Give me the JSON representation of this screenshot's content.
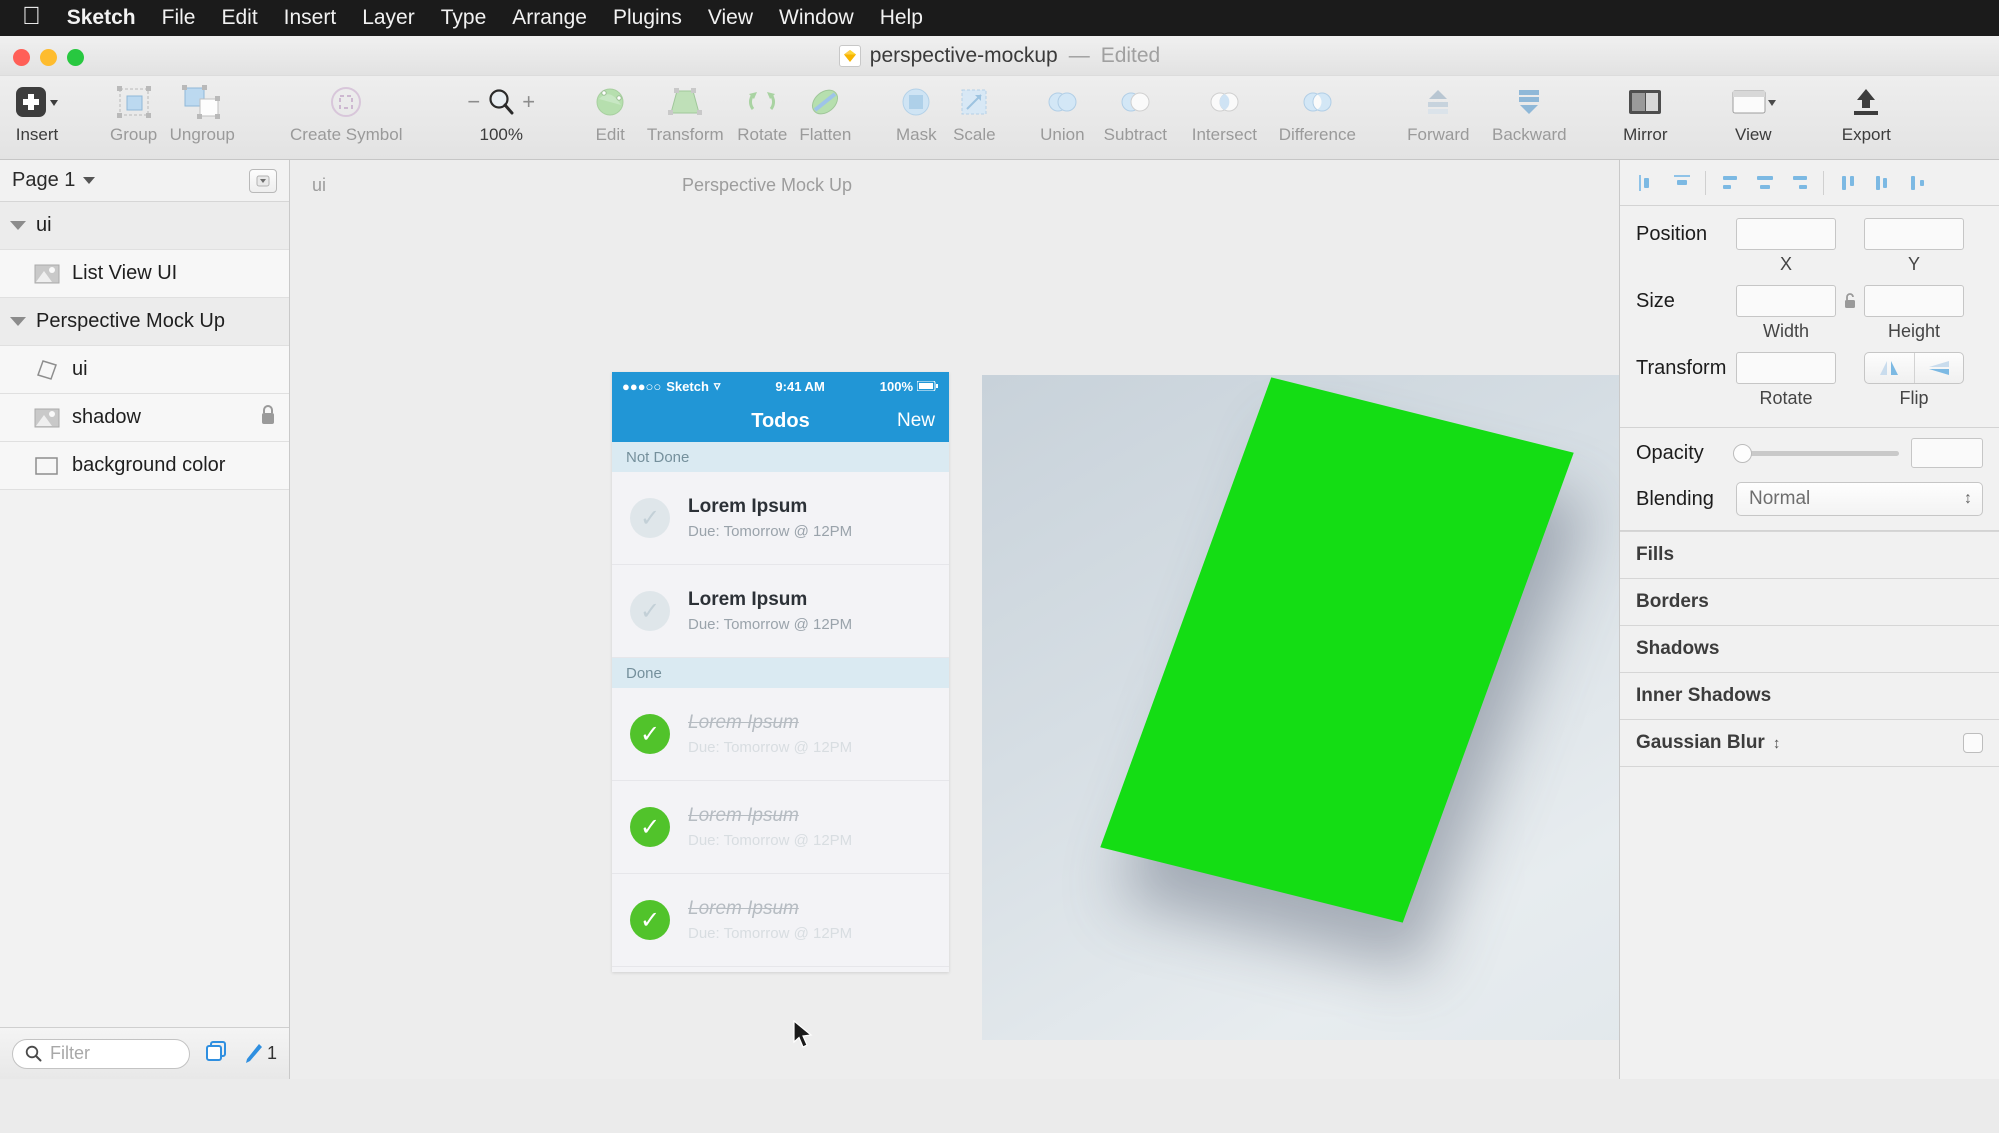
{
  "menubar": {
    "apple": "apple-logo",
    "items": [
      {
        "label": "Sketch",
        "bold": true
      },
      {
        "label": "File",
        "bold": false
      },
      {
        "label": "Edit",
        "bold": false
      },
      {
        "label": "Insert",
        "bold": false
      },
      {
        "label": "Layer",
        "bold": false
      },
      {
        "label": "Type",
        "bold": false
      },
      {
        "label": "Arrange",
        "bold": false
      },
      {
        "label": "Plugins",
        "bold": false
      },
      {
        "label": "View",
        "bold": false
      },
      {
        "label": "Window",
        "bold": false
      },
      {
        "label": "Help",
        "bold": false
      }
    ]
  },
  "titlebar": {
    "document_name": "perspective-mockup",
    "separator": "—",
    "edit_state": "Edited"
  },
  "toolbar": {
    "insert": "Insert",
    "group": "Group",
    "ungroup": "Ungroup",
    "create_symbol": "Create Symbol",
    "zoom_out": "−",
    "zoom_in": "+",
    "zoom_level": "100%",
    "edit": "Edit",
    "transform": "Transform",
    "rotate": "Rotate",
    "flatten": "Flatten",
    "mask": "Mask",
    "scale": "Scale",
    "union": "Union",
    "subtract": "Subtract",
    "intersect": "Intersect",
    "difference": "Difference",
    "forward": "Forward",
    "backward": "Backward",
    "mirror": "Mirror",
    "view": "View",
    "export": "Export"
  },
  "layers": {
    "page_name": "Page 1",
    "items": [
      {
        "name": "ui",
        "type": "group",
        "depth": 0,
        "expanded": true,
        "icon": "disclosure-triangle",
        "locked": false
      },
      {
        "name": "List View UI",
        "type": "bitmap",
        "depth": 1,
        "expanded": false,
        "icon": "image-icon",
        "locked": false
      },
      {
        "name": "Perspective Mock Up",
        "type": "group",
        "depth": 0,
        "expanded": true,
        "icon": "disclosure-triangle",
        "locked": false
      },
      {
        "name": "ui",
        "type": "shape",
        "depth": 1,
        "expanded": false,
        "icon": "parallelogram-icon",
        "locked": false
      },
      {
        "name": "shadow",
        "type": "bitmap",
        "depth": 1,
        "expanded": false,
        "icon": "image-icon",
        "locked": true
      },
      {
        "name": "background color",
        "type": "rectangle",
        "depth": 1,
        "expanded": false,
        "icon": "rectangle-icon",
        "locked": false
      }
    ],
    "filter_placeholder": "Filter",
    "pen_count": "1"
  },
  "canvas": {
    "artboard_ui_label": "ui",
    "artboard_perspective_label": "Perspective Mock Up",
    "mockup": {
      "carrier_dots": "●●●○○",
      "carrier": "Sketch",
      "wifi": "wifi-icon",
      "time": "9:41 AM",
      "battery": "100%",
      "nav_title": "Todos",
      "nav_action": "New",
      "sections": [
        {
          "header": "Not Done",
          "rows": [
            {
              "title": "Lorem Ipsum",
              "due": "Due: Tomorrow @ 12PM",
              "done": false
            },
            {
              "title": "Lorem Ipsum",
              "due": "Due: Tomorrow @ 12PM",
              "done": false
            }
          ]
        },
        {
          "header": "Done",
          "rows": [
            {
              "title": "Lorem Ipsum",
              "due": "Due: Tomorrow @ 12PM",
              "done": true
            },
            {
              "title": "Lorem Ipsum",
              "due": "Due: Tomorrow @ 12PM",
              "done": true
            },
            {
              "title": "Lorem Ipsum",
              "due": "Due: Tomorrow @ 12PM",
              "done": true
            }
          ]
        }
      ]
    },
    "card_color": "#14DD14"
  },
  "inspector": {
    "position_label": "Position",
    "x_label": "X",
    "y_label": "Y",
    "x_value": "",
    "y_value": "",
    "size_label": "Size",
    "width_label": "Width",
    "height_label": "Height",
    "width_value": "",
    "height_value": "",
    "transform_label": "Transform",
    "rotate_label": "Rotate",
    "rotate_value": "",
    "flip_label": "Flip",
    "opacity_label": "Opacity",
    "opacity_value": "",
    "blending_label": "Blending",
    "blending_value": "Normal",
    "sections": [
      {
        "label": "Fills",
        "has_checkbox": false,
        "has_stepper": false
      },
      {
        "label": "Borders",
        "has_checkbox": false,
        "has_stepper": false
      },
      {
        "label": "Shadows",
        "has_checkbox": false,
        "has_stepper": false
      },
      {
        "label": "Inner Shadows",
        "has_checkbox": false,
        "has_stepper": false
      },
      {
        "label": "Gaussian Blur",
        "has_checkbox": true,
        "has_stepper": true
      }
    ]
  }
}
